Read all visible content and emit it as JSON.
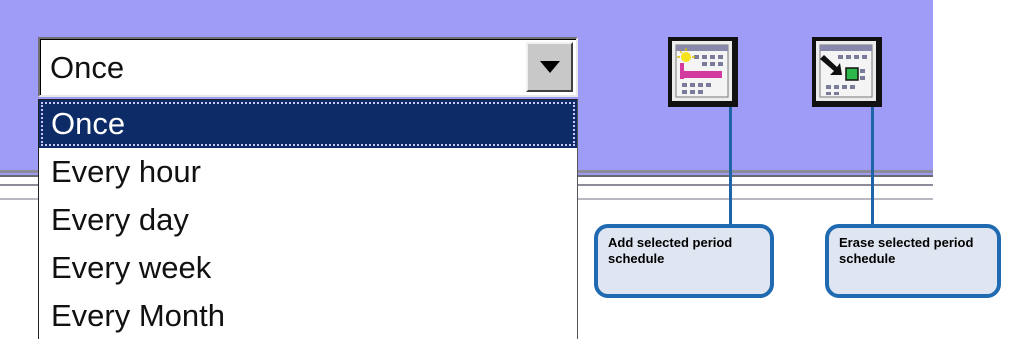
{
  "select": {
    "value": "Once",
    "arrow_icon": "triangle-down-icon"
  },
  "dropdown": {
    "options": [
      "Once",
      "Every hour",
      "Every day",
      "Every week",
      "Every Month"
    ],
    "selected_index": 0
  },
  "icons": {
    "add": "calendar-add-icon",
    "erase": "calendar-erase-icon"
  },
  "callouts": {
    "add_label": "Add selected period schedule",
    "erase_label": "Erase selected period schedule"
  },
  "colors": {
    "toolbar_bg": "#9f9cf7",
    "selection_bg": "#0d2b66",
    "callout_border": "#1f6ab0",
    "callout_bg": "#dfe6f1"
  }
}
